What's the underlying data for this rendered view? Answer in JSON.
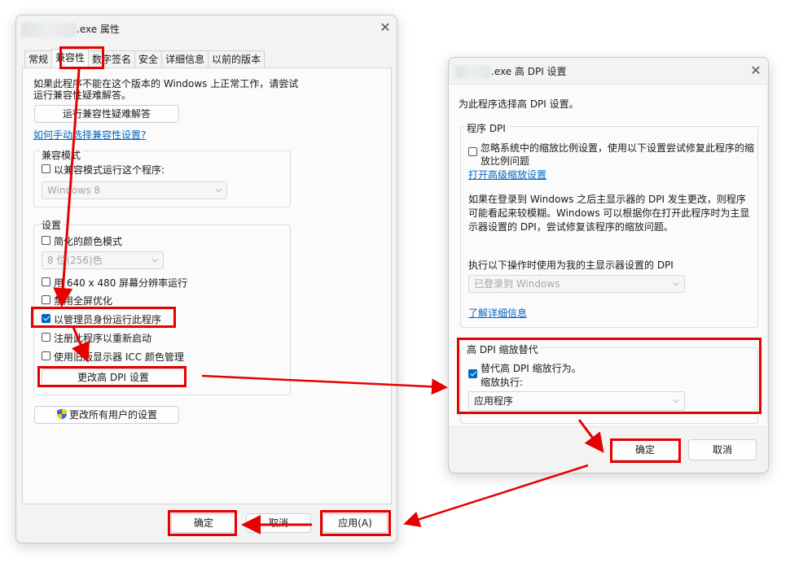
{
  "props": {
    "title_suffix": ".exe 属性",
    "tabs": [
      "常规",
      "兼容性",
      "数字签名",
      "安全",
      "详细信息",
      "以前的版本"
    ],
    "intro_line1": "如果此程序不能在这个版本的 Windows 上正常工作，请尝试",
    "intro_line2": "运行兼容性疑难解答。",
    "troubleshoot_button": "运行兼容性疑难解答",
    "manual_link": "如何手动选择兼容性设置?",
    "compat_mode_group": "兼容模式",
    "compat_mode_checkbox": "以兼容模式运行这个程序:",
    "compat_mode_select": "Windows 8",
    "settings_group": "设置",
    "reduced_color": "简化的颜色模式",
    "color_select": "8 位(256)色",
    "res_640": "用 640 x 480 屏幕分辨率运行",
    "disable_fullscreen": "禁用全屏优化",
    "run_as_admin": "以管理员身份运行此程序",
    "register_restart": "注册此程序以重新启动",
    "legacy_icc": "使用旧版显示器 ICC 颜色管理",
    "change_dpi_button": "更改高 DPI 设置",
    "all_users_button": "更改所有用户的设置",
    "ok": "确定",
    "cancel": "取消",
    "apply": "应用(A)"
  },
  "dpi": {
    "title_suffix": ".exe 高 DPI 设置",
    "heading": "为此程序选择高 DPI 设置。",
    "program_dpi_group": "程序 DPI",
    "ignore_scaling_line1": "忽略系统中的缩放比例设置，使用以下设置尝试修复此程序的缩",
    "ignore_scaling_line2": "放比例问题",
    "advanced_scaling_link": "打开高级缩放设置",
    "desc_line1": "如果在登录到 Windows 之后主显示器的 DPI 发生更改，则程序",
    "desc_line2": "可能看起来较模糊。Windows 可以根据你在打开此程序时为主显",
    "desc_line3": "示器设置的 DPI，尝试修复该程序的缩放问题。",
    "use_dpi_label": "执行以下操作时使用为我的主显示器设置的 DPI",
    "use_dpi_select": "已登录到 Windows",
    "learn_more_link": "了解详细信息",
    "override_group": "高 DPI 缩放替代",
    "override_checkbox": "替代高 DPI 缩放行为。",
    "scaling_by_label": "缩放执行:",
    "scaling_by_select": "应用程序",
    "ok": "确定",
    "cancel": "取消"
  },
  "icons": {
    "close": "close-icon",
    "dropdown": "chevron-down-icon",
    "admin_shield": "uac-shield-icon"
  },
  "colors": {
    "highlight": "#e60000",
    "accent": "#0067c0"
  }
}
